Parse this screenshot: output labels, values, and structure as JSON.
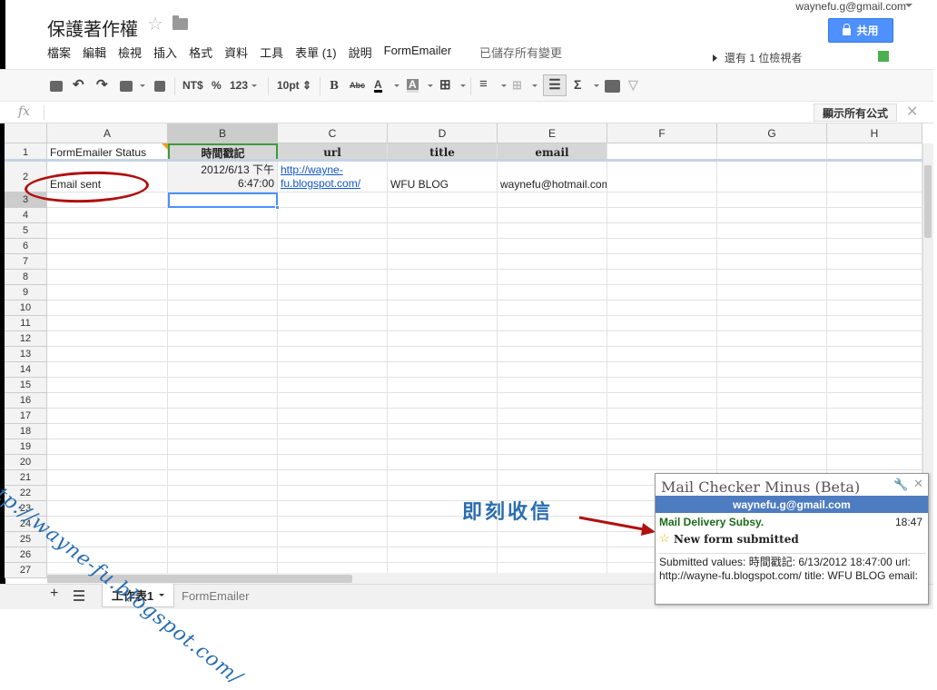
{
  "doc": {
    "title": "保護著作權"
  },
  "account": {
    "email": "waynefu.g@gmail.com"
  },
  "share": {
    "label": "共用"
  },
  "menu": {
    "items": [
      "檔案",
      "編輯",
      "檢視",
      "插入",
      "格式",
      "資料",
      "工具",
      "表單 (1)",
      "說明",
      "FormEmailer"
    ],
    "save_status": "已儲存所有變更"
  },
  "viewers": {
    "text": "還有 1 位檢視者"
  },
  "toolbar": {
    "currency": "NT$",
    "percent": "%",
    "number_format": "123",
    "font_size": "10pt",
    "bold": "B",
    "strike": "Abc",
    "font_color": "A",
    "sum": "Σ"
  },
  "formula": {
    "fx": "fx",
    "show_all": "顯示所有公式",
    "close": "✕"
  },
  "columns": [
    "A",
    "B",
    "C",
    "D",
    "E",
    "F",
    "G",
    "H"
  ],
  "rows": [
    "1",
    "2",
    "3",
    "4",
    "5",
    "6",
    "7",
    "8",
    "9",
    "10",
    "11",
    "12",
    "13",
    "14",
    "15",
    "16",
    "17",
    "18",
    "19",
    "20",
    "21",
    "22",
    "23",
    "24",
    "25",
    "26",
    "27"
  ],
  "header_row": {
    "a": "FormEmailer Status",
    "b": "時間戳記",
    "c": "url",
    "d": "title",
    "e": "email"
  },
  "data_row": {
    "a": "Email sent",
    "b_line1": "2012/6/13 下午",
    "b_line2": "6:47:00",
    "c_line1": "http://wayne-",
    "c_line2": "fu.blogspot.com/",
    "d": "WFU BLOG",
    "e": "waynefu@hotmail.com"
  },
  "tabs": {
    "sheet1": "工作表1",
    "sheet2": "FormEmailer",
    "add": "+"
  },
  "watermark": "http://wayne-fu.blogspot.com/",
  "annotation": "即刻收信",
  "popup": {
    "title": "Mail Checker Minus (Beta)",
    "account": "waynefu.g@gmail.com",
    "sender": "Mail Delivery Subsy.",
    "time": "18:47",
    "subject": "New form submitted",
    "body": "Submitted values: 時間戳記: 6/13/2012 18:47:00 url: http://wayne-fu.blogspot.com/ title: WFU BLOG email:"
  },
  "colors": {
    "accent": "#4d90fe",
    "popup_header": "#4d7cc1",
    "annotation": "#2a6eb0",
    "oval": "#b01010"
  }
}
